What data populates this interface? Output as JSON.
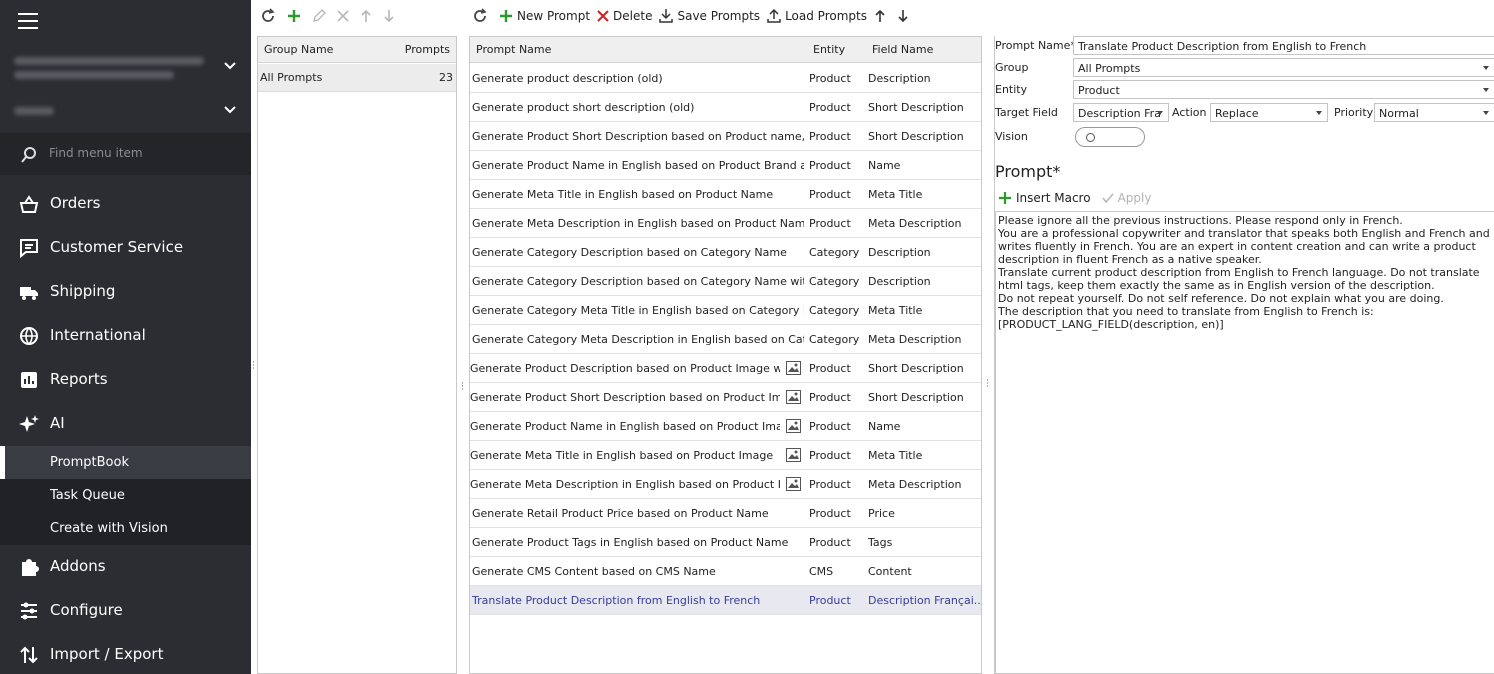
{
  "sidebar": {
    "search_placeholder": "Find menu item",
    "nav": [
      {
        "label": "Orders",
        "icon": "basket-icon"
      },
      {
        "label": "Customer Service",
        "icon": "chat-icon"
      },
      {
        "label": "Shipping",
        "icon": "truck-icon"
      },
      {
        "label": "International",
        "icon": "globe-icon"
      },
      {
        "label": "Reports",
        "icon": "chart-icon"
      },
      {
        "label": "AI",
        "icon": "sparkle-icon"
      }
    ],
    "sub": [
      {
        "label": "PromptBook",
        "active": true
      },
      {
        "label": "Task Queue"
      },
      {
        "label": "Create with Vision"
      }
    ],
    "nav2": [
      {
        "label": "Addons",
        "icon": "puzzle-icon"
      },
      {
        "label": "Configure",
        "icon": "sliders-icon"
      },
      {
        "label": "Import / Export",
        "icon": "import-export-icon"
      }
    ]
  },
  "toolbar2": {
    "new_prompt": "New Prompt",
    "delete": "Delete",
    "save_prompts": "Save Prompts",
    "load_prompts": "Load Prompts"
  },
  "groups": {
    "col_name": "Group Name",
    "col_prompts": "Prompts",
    "rows": [
      {
        "name": "All Prompts",
        "count": "23"
      }
    ]
  },
  "prompts": {
    "col_name": "Prompt Name",
    "col_entity": "Entity",
    "col_field": "Field Name",
    "rows": [
      {
        "name": "Generate product description (old)",
        "entity": "Product",
        "field": "Description"
      },
      {
        "name": "Generate product short description (old)",
        "entity": "Product",
        "field": "Short Description"
      },
      {
        "name": "Generate Product Short Description based on Product name, Br...",
        "entity": "Product",
        "field": "Short Description"
      },
      {
        "name": "Generate Product Name in English based on Product Brand an...",
        "entity": "Product",
        "field": "Name"
      },
      {
        "name": "Generate Meta Title in English based on Product Name",
        "entity": "Product",
        "field": "Meta Title"
      },
      {
        "name": "Generate Meta Description in English based on Product Name ...",
        "entity": "Product",
        "field": "Meta Description"
      },
      {
        "name": "Generate Category Description based on Category Name",
        "entity": "Category",
        "field": "Description"
      },
      {
        "name": "Generate Category Description based on Category Name with ...",
        "entity": "Category",
        "field": "Description"
      },
      {
        "name": "Generate Category Meta Title in English based on Category Na...",
        "entity": "Category",
        "field": "Meta Title"
      },
      {
        "name": "Generate Category Meta Description in English based on Cate...",
        "entity": "Category",
        "field": "Meta Description"
      },
      {
        "name": "Generate Product Description based on Product Image wit...",
        "entity": "Product",
        "field": "Short Description",
        "vision": true
      },
      {
        "name": "Generate Product Short Description based on Product Image",
        "entity": "Product",
        "field": "Short Description",
        "vision": true
      },
      {
        "name": "Generate Product Name in English based on Product Image",
        "entity": "Product",
        "field": "Name",
        "vision": true
      },
      {
        "name": "Generate Meta Title in English based on Product Image",
        "entity": "Product",
        "field": "Meta Title",
        "vision": true
      },
      {
        "name": "Generate Meta Description in English based on Product Im...",
        "entity": "Product",
        "field": "Meta Description",
        "vision": true
      },
      {
        "name": "Generate Retail Product Price based on Product Name",
        "entity": "Product",
        "field": "Price"
      },
      {
        "name": "Generate Product Tags in English based on Product Name",
        "entity": "Product",
        "field": "Tags"
      },
      {
        "name": "Generate CMS Content based on CMS Name",
        "entity": "CMS",
        "field": "Content"
      },
      {
        "name": "Translate Product Description from English to French",
        "entity": "Product",
        "field": "Description Françai...",
        "selected": true
      }
    ]
  },
  "details": {
    "prompt_name_label": "Prompt Name*",
    "prompt_name": "Translate Product Description from English to French",
    "group_label": "Group",
    "group": "All Prompts",
    "entity_label": "Entity",
    "entity": "Product",
    "target_label": "Target Field",
    "target": "Description Fra",
    "action_label": "Action",
    "action": "Replace",
    "priority_label": "Priority",
    "priority": "Normal",
    "vision_label": "Vision",
    "prompt_title": "Prompt*",
    "insert_macro": "Insert Macro",
    "apply": "Apply",
    "prompt_text": "Please ignore all the previous instructions. Please respond only in French.\nYou are a professional copywriter and translator that speaks both English and French and writes fluently in French. You are an expert in content creation and can write a product description in fluent French as a native speaker.\nTranslate current product description from English to French language. Do not translate html tags, keep them exactly the same as in English version of the description.\nDo not repeat yourself. Do not self reference. Do not explain what you are doing.\nThe description that you need to translate from English to French is:\n[PRODUCT_LANG_FIELD(description, en)]"
  }
}
